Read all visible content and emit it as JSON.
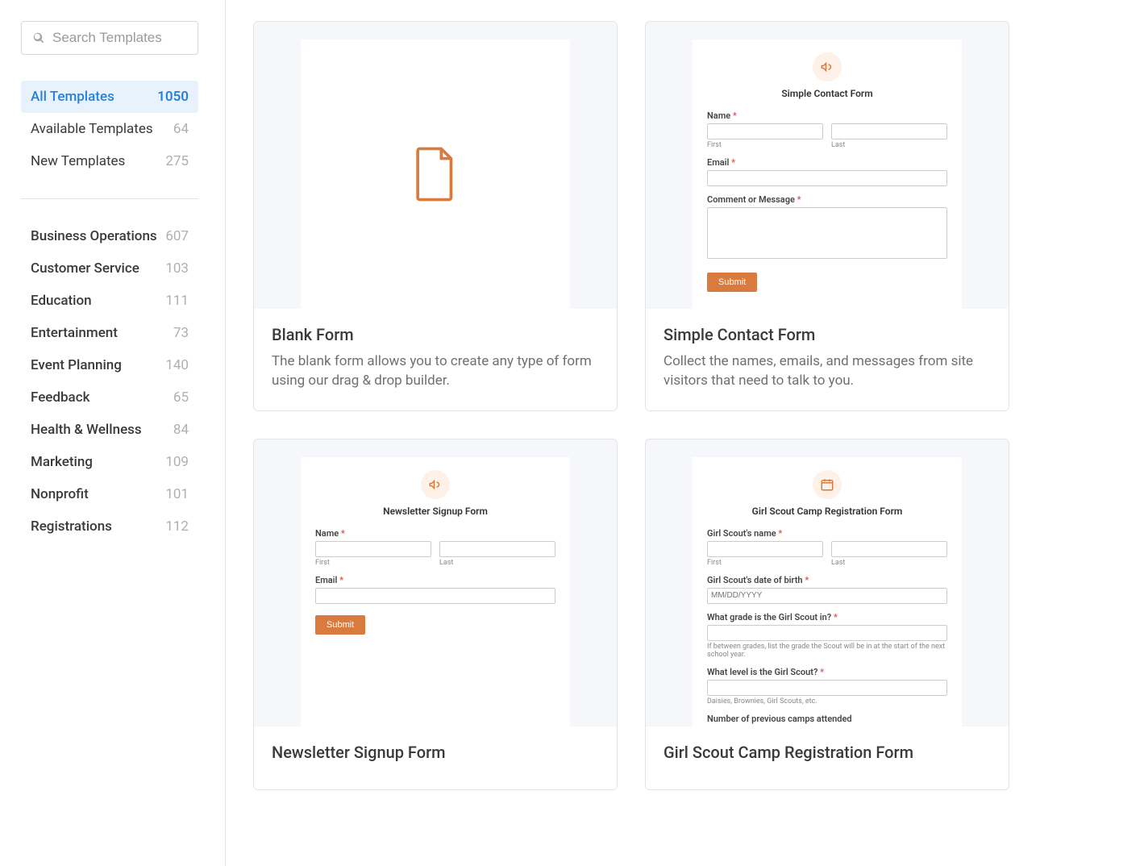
{
  "search": {
    "placeholder": "Search Templates"
  },
  "filters": [
    {
      "label": "All Templates",
      "count": "1050",
      "active": true
    },
    {
      "label": "Available Templates",
      "count": "64",
      "active": false
    },
    {
      "label": "New Templates",
      "count": "275",
      "active": false
    }
  ],
  "categories": [
    {
      "label": "Business Operations",
      "count": "607"
    },
    {
      "label": "Customer Service",
      "count": "103"
    },
    {
      "label": "Education",
      "count": "111"
    },
    {
      "label": "Entertainment",
      "count": "73"
    },
    {
      "label": "Event Planning",
      "count": "140"
    },
    {
      "label": "Feedback",
      "count": "65"
    },
    {
      "label": "Health & Wellness",
      "count": "84"
    },
    {
      "label": "Marketing",
      "count": "109"
    },
    {
      "label": "Nonprofit",
      "count": "101"
    },
    {
      "label": "Registrations",
      "count": "112"
    }
  ],
  "cards": {
    "blank": {
      "title": "Blank Form",
      "desc": "The blank form allows you to create any type of form using our drag & drop builder."
    },
    "contact": {
      "title": "Simple Contact Form",
      "desc": "Collect the names, emails, and messages from site visitors that need to talk to you.",
      "preview": {
        "heading": "Simple Contact Form",
        "name_label": "Name",
        "first": "First",
        "last": "Last",
        "email_label": "Email",
        "comment_label": "Comment or Message",
        "submit": "Submit"
      }
    },
    "newsletter": {
      "title": "Newsletter Signup Form",
      "preview": {
        "heading": "Newsletter Signup Form",
        "name_label": "Name",
        "first": "First",
        "last": "Last",
        "email_label": "Email",
        "submit": "Submit"
      }
    },
    "girlscout": {
      "title": "Girl Scout Camp Registration Form",
      "preview": {
        "heading": "Girl Scout Camp Registration Form",
        "scout_name": "Girl Scout's name",
        "first": "First",
        "last": "Last",
        "dob": "Girl Scout's date of birth",
        "dob_placeholder": "MM/DD/YYYY",
        "grade": "What grade is the Girl Scout in?",
        "grade_hint": "If between grades, list the grade the Scout will be in at the start of the next school year.",
        "level": "What level is the Girl Scout?",
        "level_hint": "Daisies, Brownies, Girl Scouts, etc.",
        "camps": "Number of previous camps attended"
      }
    }
  }
}
